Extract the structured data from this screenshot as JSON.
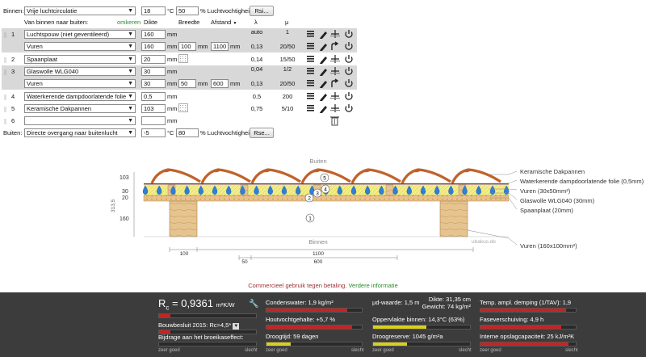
{
  "inside": {
    "label": "Binnen:",
    "type": "Vrije luchtcirculatie",
    "temp": "18",
    "temp_unit": "°C",
    "rh": "50",
    "rh_unit": "% Luchtvochtigheid",
    "rs_button": "Rsi..."
  },
  "outside": {
    "label": "Buiten:",
    "type": "Directe overgang naar buitenlucht",
    "temp": "-5",
    "temp_unit": "°C",
    "rh": "80",
    "rh_unit": "% Luchtvochtigheid",
    "rs_button": "Rse..."
  },
  "headers": {
    "order": "Van binnen naar buiten:",
    "reverse": "omkeren",
    "thickness": "Dikte",
    "width": "Breedte",
    "spacing": "Afstand",
    "lambda": "λ",
    "mu": "μ"
  },
  "layers": [
    {
      "num": "1",
      "material": "Luchtspouw (niet geventileerd)",
      "thickness": "160",
      "unit": "mm",
      "lambda": "auto",
      "mu": "1",
      "shaded": true,
      "sub": {
        "material": "Vuren",
        "thickness": "160",
        "width": "100",
        "spacing": "1100",
        "lambda": "0,13",
        "mu": "20/50"
      }
    },
    {
      "num": "2",
      "material": "Spaanplaat",
      "thickness": "20",
      "unit": "mm",
      "lambda": "0,14",
      "mu": "15/50",
      "shaded": false
    },
    {
      "num": "3",
      "material": "Glaswolle WLG040",
      "thickness": "30",
      "unit": "mm",
      "lambda": "0,04",
      "mu": "1/2",
      "shaded": true,
      "sub": {
        "material": "Vuren",
        "thickness": "30",
        "width": "50",
        "spacing": "600",
        "lambda": "0,13",
        "mu": "20/50"
      }
    },
    {
      "num": "4",
      "material": "Waterkerende dampdoorlatende folie",
      "thickness": "0,5",
      "unit": "mm",
      "lambda": "0,5",
      "mu": "200",
      "shaded": false
    },
    {
      "num": "5",
      "material": "Keramische Dakpannen",
      "thickness": "103",
      "unit": "mm",
      "lambda": "0,75",
      "mu": "5/10",
      "shaded": false
    },
    {
      "num": "6",
      "material": "",
      "thickness": "",
      "unit": "mm",
      "lambda": "",
      "mu": "",
      "shaded": false
    }
  ],
  "units": {
    "mm": "mm"
  },
  "diagram": {
    "top_label": "Buiten",
    "bottom_label": "Binnen",
    "left_dims": [
      "103",
      "30",
      "20",
      "160"
    ],
    "total_dim": "313,5",
    "bottom_dims": {
      "d100": "100",
      "d1100": "1100",
      "d50": "50",
      "d600": "600"
    },
    "watermark": "ubakus.de",
    "circles": [
      "1",
      "2",
      "3",
      "4",
      "5"
    ],
    "legend": [
      "Keramische Dakpannen",
      "Waterkerende dampdoorlatende folie (0,5mm)",
      "Vuren (30x50mm²)",
      "Glaswolle WLG040 (30mm)",
      "Spaanplaat (20mm)",
      "Vuren (160x100mm²)"
    ]
  },
  "notice": {
    "text": "Commercieel gebruik tegen betaling.",
    "link": "Verdere informatie"
  },
  "results": {
    "rc_label": "R",
    "rc_sub": "c",
    "rc_value": "= 0,9361",
    "rc_unit": "m²K/W",
    "bouwbesluit": "Bouwbesluit 2015: Rc>4,5*",
    "greenhouse": "Bijdrage aan het broeikaseffect:",
    "condens": "Condenswater: 1,9 kg/m²",
    "moisture": "Houtvochtgehalte: +5,7 %",
    "drying": "Droogtijd: 59 dagen",
    "sd": "μd-waarde: 1,5 m",
    "thick": "Dikte: 31,35 cm",
    "weight": "Gewicht: 74 kg/m²",
    "surface": "Oppervlakte binnen: 14,3°C (63%)",
    "reserve": "Droogreserve: 1045 g/m²a",
    "temp_damp": "Temp. ampl. demping (1/TAV): 1,9",
    "phase": "Faseverschuiving: 4,9 h",
    "capacity": "Interne opslagcapaciteit: 25 kJ/m²K",
    "good": "zeer goed",
    "bad": "slecht",
    "levels": {
      "rc": 0.12,
      "condens": 0.85,
      "moisture": 0.9,
      "drying": 0.25,
      "surface": 0.55,
      "reserve": 0.35,
      "temp_damp": 0.9,
      "phase": 0.85,
      "capacity": 0.92
    }
  }
}
